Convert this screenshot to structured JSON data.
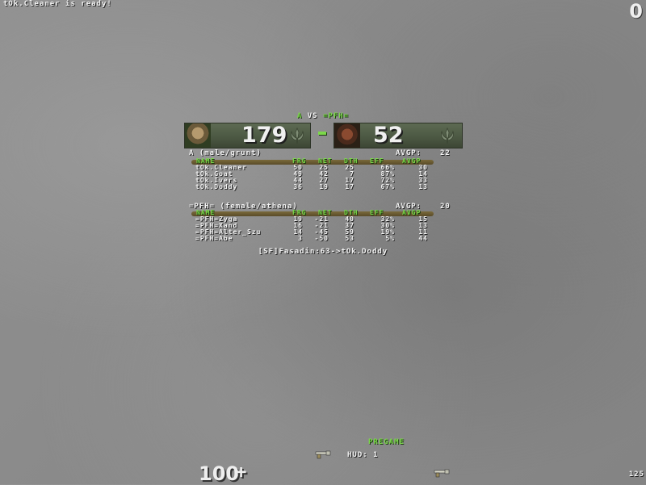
{
  "notice": "tOk.Cleaner is ready!",
  "top_right_score": "0",
  "versus": {
    "left": "A",
    "vs": "VS",
    "right": "=PFH="
  },
  "scores": {
    "left": "179",
    "right": "52"
  },
  "team_a": {
    "header": "A (male/grunt)",
    "avgp_label": "AVGP:",
    "avgp_value": "22",
    "columns": [
      "NAME",
      "FRG",
      "NET",
      "DTH",
      "EFF",
      "AVGP"
    ],
    "players": [
      {
        "name": "tOk.Cleaner",
        "frg": "50",
        "net": "25",
        "dth": "25",
        "eff": "66%",
        "avgp": "30"
      },
      {
        "name": "tOk.Goat",
        "frg": "49",
        "net": "42",
        "dth": "7",
        "eff": "87%",
        "avgp": "14"
      },
      {
        "name": "tOk.Ivers",
        "frg": "44",
        "net": "27",
        "dth": "17",
        "eff": "72%",
        "avgp": "33"
      },
      {
        "name": "tOk.Doddy",
        "frg": "36",
        "net": "19",
        "dth": "17",
        "eff": "67%",
        "avgp": "13"
      }
    ]
  },
  "team_b": {
    "header": "=PFH= (female/athena)",
    "avgp_label": "AVGP:",
    "avgp_value": "20",
    "columns": [
      "NAME",
      "FRG",
      "NET",
      "DTH",
      "EFF",
      "AVGP"
    ],
    "players": [
      {
        "name": "=PFH=Zyga",
        "frg": "19",
        "net": "-21",
        "dth": "40",
        "eff": "32%",
        "avgp": "15"
      },
      {
        "name": "=PFH=Xand",
        "frg": "16",
        "net": "-21",
        "dth": "37",
        "eff": "30%",
        "avgp": "13"
      },
      {
        "name": "=PFH=Alter_Szu",
        "frg": "14",
        "net": "-45",
        "dth": "59",
        "eff": "19%",
        "avgp": "11"
      },
      {
        "name": "=PFH=Abe",
        "frg": "3",
        "net": "-50",
        "dth": "53",
        "eff": "5%",
        "avgp": "44"
      }
    ]
  },
  "frag_message": "[SF]Fasadin:63->tOk.Doddy",
  "pregame": "PREGAME",
  "hud": "HUD: 1",
  "health": "100",
  "health_plus": "+",
  "fps": "125",
  "icons": [
    "player-face-icon",
    "quake-logo-icon",
    "shotgun-icon"
  ],
  "colors": {
    "green": "#7cd84a",
    "bar": "#4b5742",
    "background": "#8c8c8c"
  }
}
